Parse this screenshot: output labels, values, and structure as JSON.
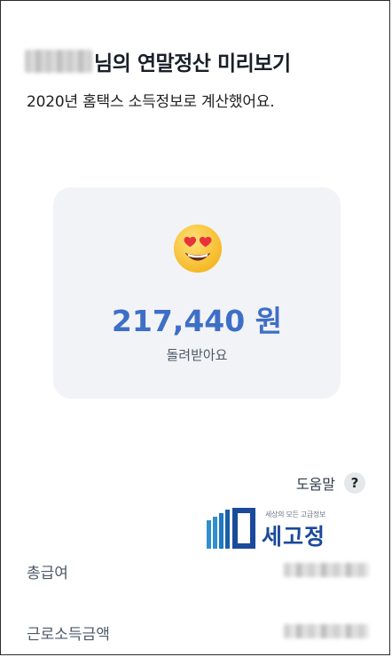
{
  "header": {
    "title_suffix": "님의 연말정산 미리보기",
    "subtitle": "2020년 홈택스 소득정보로 계산했어요."
  },
  "result_card": {
    "emoji": "heart-eyes-emoji",
    "amount": "217,440 원",
    "caption": "돌려받아요"
  },
  "help": {
    "label": "도움말",
    "icon_glyph": "?"
  },
  "watermark": {
    "tagline": "세상의 모든 고급정보",
    "name": "세고정"
  },
  "details": [
    {
      "label": "총급여"
    },
    {
      "label": "근로소득금액"
    }
  ],
  "colors": {
    "accent": "#3e6fc7",
    "card_bg": "#f2f3f6",
    "watermark": "#1a4a9a"
  }
}
